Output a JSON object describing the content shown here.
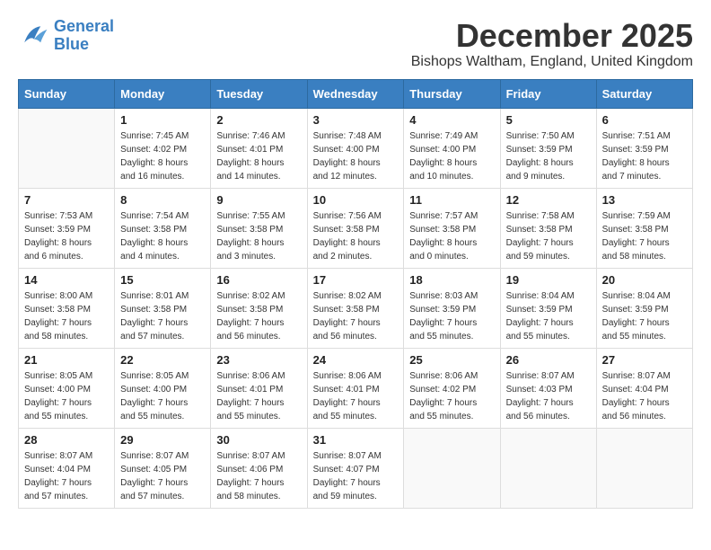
{
  "header": {
    "logo_line1": "General",
    "logo_line2": "Blue",
    "month_title": "December 2025",
    "location": "Bishops Waltham, England, United Kingdom"
  },
  "days_of_week": [
    "Sunday",
    "Monday",
    "Tuesday",
    "Wednesday",
    "Thursday",
    "Friday",
    "Saturday"
  ],
  "weeks": [
    [
      {
        "day": "",
        "info": ""
      },
      {
        "day": "1",
        "info": "Sunrise: 7:45 AM\nSunset: 4:02 PM\nDaylight: 8 hours\nand 16 minutes."
      },
      {
        "day": "2",
        "info": "Sunrise: 7:46 AM\nSunset: 4:01 PM\nDaylight: 8 hours\nand 14 minutes."
      },
      {
        "day": "3",
        "info": "Sunrise: 7:48 AM\nSunset: 4:00 PM\nDaylight: 8 hours\nand 12 minutes."
      },
      {
        "day": "4",
        "info": "Sunrise: 7:49 AM\nSunset: 4:00 PM\nDaylight: 8 hours\nand 10 minutes."
      },
      {
        "day": "5",
        "info": "Sunrise: 7:50 AM\nSunset: 3:59 PM\nDaylight: 8 hours\nand 9 minutes."
      },
      {
        "day": "6",
        "info": "Sunrise: 7:51 AM\nSunset: 3:59 PM\nDaylight: 8 hours\nand 7 minutes."
      }
    ],
    [
      {
        "day": "7",
        "info": "Sunrise: 7:53 AM\nSunset: 3:59 PM\nDaylight: 8 hours\nand 6 minutes."
      },
      {
        "day": "8",
        "info": "Sunrise: 7:54 AM\nSunset: 3:58 PM\nDaylight: 8 hours\nand 4 minutes."
      },
      {
        "day": "9",
        "info": "Sunrise: 7:55 AM\nSunset: 3:58 PM\nDaylight: 8 hours\nand 3 minutes."
      },
      {
        "day": "10",
        "info": "Sunrise: 7:56 AM\nSunset: 3:58 PM\nDaylight: 8 hours\nand 2 minutes."
      },
      {
        "day": "11",
        "info": "Sunrise: 7:57 AM\nSunset: 3:58 PM\nDaylight: 8 hours\nand 0 minutes."
      },
      {
        "day": "12",
        "info": "Sunrise: 7:58 AM\nSunset: 3:58 PM\nDaylight: 7 hours\nand 59 minutes."
      },
      {
        "day": "13",
        "info": "Sunrise: 7:59 AM\nSunset: 3:58 PM\nDaylight: 7 hours\nand 58 minutes."
      }
    ],
    [
      {
        "day": "14",
        "info": "Sunrise: 8:00 AM\nSunset: 3:58 PM\nDaylight: 7 hours\nand 58 minutes."
      },
      {
        "day": "15",
        "info": "Sunrise: 8:01 AM\nSunset: 3:58 PM\nDaylight: 7 hours\nand 57 minutes."
      },
      {
        "day": "16",
        "info": "Sunrise: 8:02 AM\nSunset: 3:58 PM\nDaylight: 7 hours\nand 56 minutes."
      },
      {
        "day": "17",
        "info": "Sunrise: 8:02 AM\nSunset: 3:58 PM\nDaylight: 7 hours\nand 56 minutes."
      },
      {
        "day": "18",
        "info": "Sunrise: 8:03 AM\nSunset: 3:59 PM\nDaylight: 7 hours\nand 55 minutes."
      },
      {
        "day": "19",
        "info": "Sunrise: 8:04 AM\nSunset: 3:59 PM\nDaylight: 7 hours\nand 55 minutes."
      },
      {
        "day": "20",
        "info": "Sunrise: 8:04 AM\nSunset: 3:59 PM\nDaylight: 7 hours\nand 55 minutes."
      }
    ],
    [
      {
        "day": "21",
        "info": "Sunrise: 8:05 AM\nSunset: 4:00 PM\nDaylight: 7 hours\nand 55 minutes."
      },
      {
        "day": "22",
        "info": "Sunrise: 8:05 AM\nSunset: 4:00 PM\nDaylight: 7 hours\nand 55 minutes."
      },
      {
        "day": "23",
        "info": "Sunrise: 8:06 AM\nSunset: 4:01 PM\nDaylight: 7 hours\nand 55 minutes."
      },
      {
        "day": "24",
        "info": "Sunrise: 8:06 AM\nSunset: 4:01 PM\nDaylight: 7 hours\nand 55 minutes."
      },
      {
        "day": "25",
        "info": "Sunrise: 8:06 AM\nSunset: 4:02 PM\nDaylight: 7 hours\nand 55 minutes."
      },
      {
        "day": "26",
        "info": "Sunrise: 8:07 AM\nSunset: 4:03 PM\nDaylight: 7 hours\nand 56 minutes."
      },
      {
        "day": "27",
        "info": "Sunrise: 8:07 AM\nSunset: 4:04 PM\nDaylight: 7 hours\nand 56 minutes."
      }
    ],
    [
      {
        "day": "28",
        "info": "Sunrise: 8:07 AM\nSunset: 4:04 PM\nDaylight: 7 hours\nand 57 minutes."
      },
      {
        "day": "29",
        "info": "Sunrise: 8:07 AM\nSunset: 4:05 PM\nDaylight: 7 hours\nand 57 minutes."
      },
      {
        "day": "30",
        "info": "Sunrise: 8:07 AM\nSunset: 4:06 PM\nDaylight: 7 hours\nand 58 minutes."
      },
      {
        "day": "31",
        "info": "Sunrise: 8:07 AM\nSunset: 4:07 PM\nDaylight: 7 hours\nand 59 minutes."
      },
      {
        "day": "",
        "info": ""
      },
      {
        "day": "",
        "info": ""
      },
      {
        "day": "",
        "info": ""
      }
    ]
  ]
}
